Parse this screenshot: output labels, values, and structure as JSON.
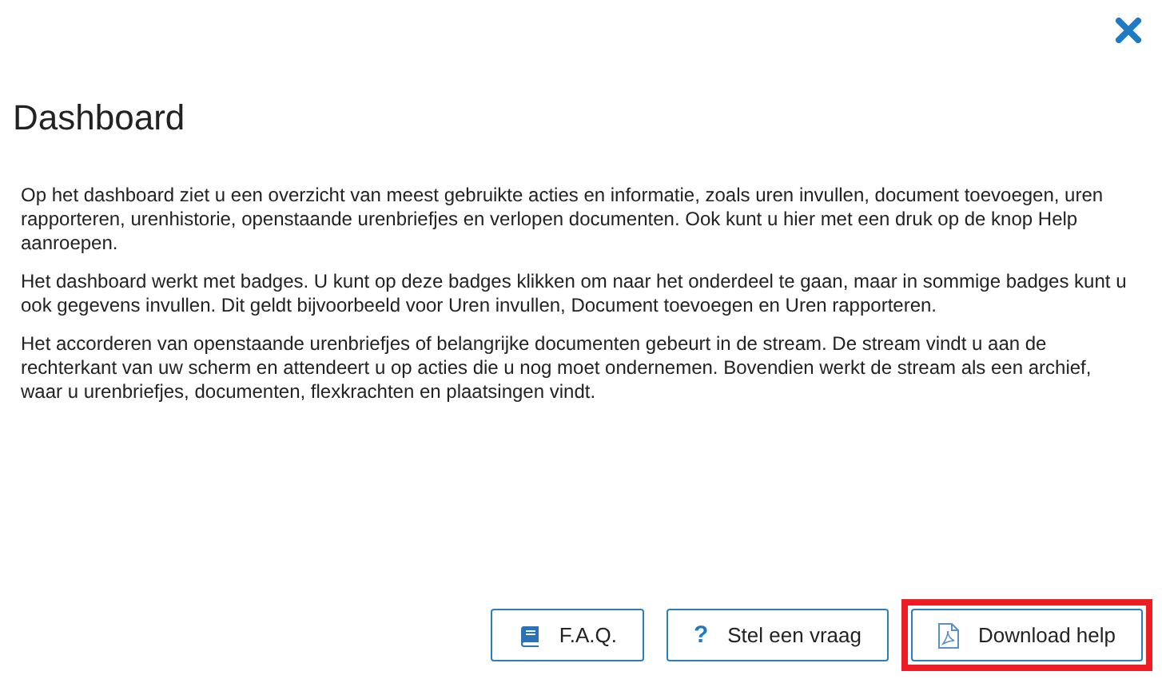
{
  "title": "Dashboard",
  "paragraphs": [
    "Op het dashboard ziet u een overzicht van meest gebruikte acties en informatie, zoals uren invullen, document toevoegen, uren rapporteren, urenhistorie, openstaande urenbriefjes en verlopen documenten. Ook kunt u hier met een druk op de knop Help aanroepen.",
    "Het dashboard werkt met badges. U kunt op deze badges klikken om naar het onderdeel te gaan, maar in sommige badges kunt u ook gegevens invullen. Dit geldt bijvoorbeeld voor Uren invullen, Document toevoegen en Uren rapporteren.",
    "Het accorderen van openstaande urenbriefjes of belangrijke documenten gebeurt in de stream. De stream vindt u aan de rechterkant van uw scherm en attendeert u op acties die u nog moet ondernemen. Bovendien werkt de stream als een archief, waar u urenbriefjes, documenten, flexkrachten en plaatsingen vindt."
  ],
  "buttons": [
    {
      "label": "F.A.Q.",
      "kind": "book",
      "highlighted": false
    },
    {
      "label": "Stel een vraag",
      "kind": "question",
      "icon_glyph": "?",
      "highlighted": false
    },
    {
      "label": "Download help",
      "kind": "pdf",
      "highlighted": true
    }
  ]
}
